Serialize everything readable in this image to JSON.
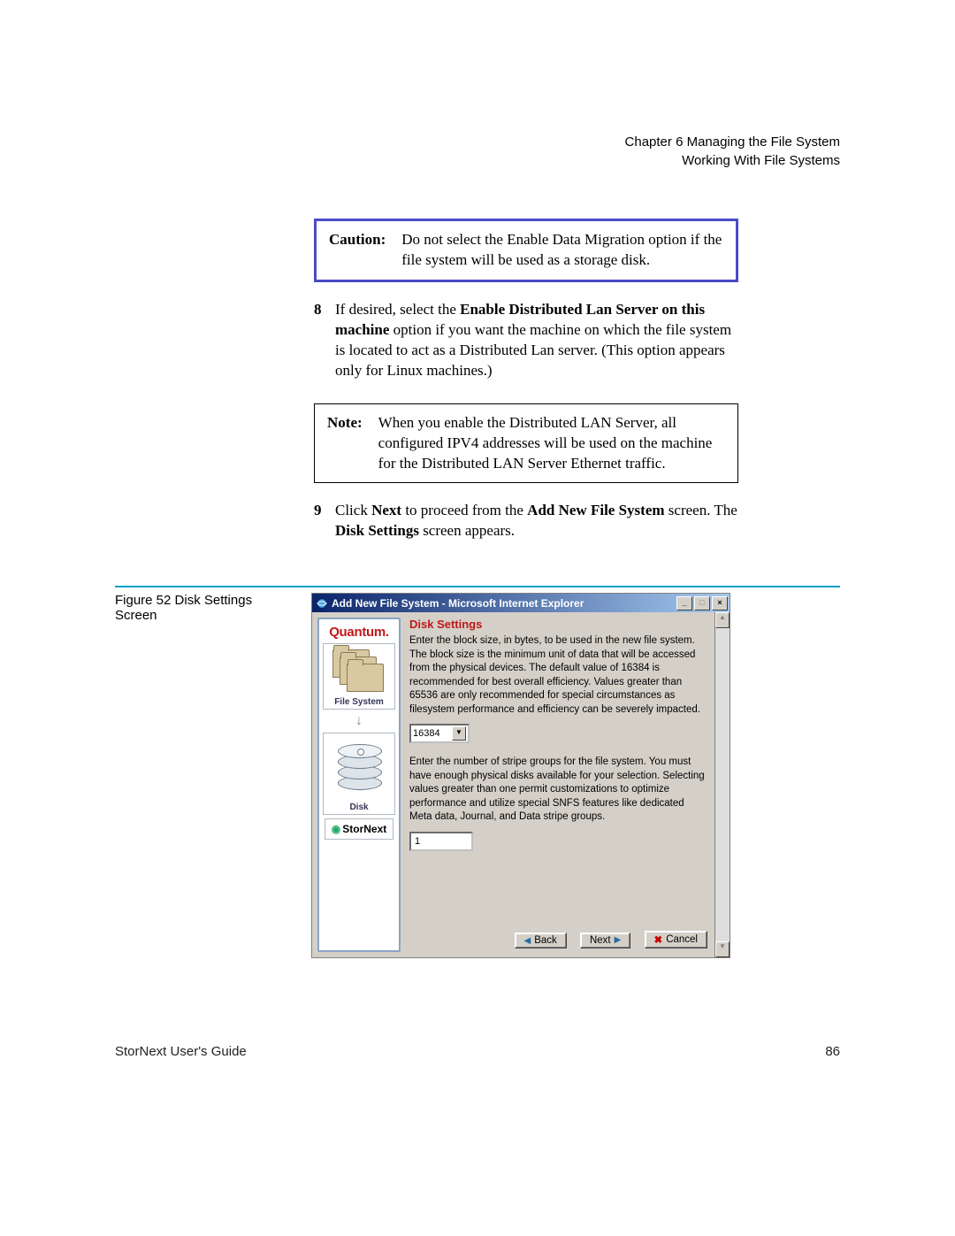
{
  "header": {
    "chapter_line": "Chapter 6  Managing the File System",
    "section_line": "Working With File Systems"
  },
  "caution": {
    "label": "Caution:",
    "text": "Do not select the Enable Data Migration option if the file system will be used as a storage disk."
  },
  "step8": {
    "num": "8",
    "prefix": "If desired, select the ",
    "bold1": "Enable Distributed Lan Server on this machine",
    "suffix": " option if you want the machine on which the file system is located to act as a Distributed Lan server. (This option appears only for Linux machines.)"
  },
  "note": {
    "label": "Note:",
    "text": "When you enable the Distributed LAN Server, all configured IPV4 addresses will be used on the machine for the Distributed LAN Server Ethernet traffic."
  },
  "step9": {
    "num": "9",
    "t1": "Click ",
    "b1": "Next",
    "t2": " to proceed from the ",
    "b2": "Add New File System",
    "t3": " screen. The ",
    "b3": "Disk Settings",
    "t4": " screen appears."
  },
  "figure": {
    "caption": "Figure 52  Disk Settings Screen"
  },
  "screenshot": {
    "title": "Add New File System - Microsoft Internet Explorer",
    "sidebar": {
      "brand": "Quantum.",
      "fs_label": "File System",
      "disk_label": "Disk",
      "stornext": "StorNext"
    },
    "panel_title": "Disk Settings",
    "para1": "Enter the block size, in bytes, to be used in the new file system. The block size is the minimum unit of data that will be accessed from the physical devices. The default value of 16384 is recommended for best overall efficiency. Values greater than 65536 are only recommended for special circumstances as filesystem performance and efficiency can be severely impacted.",
    "block_size_value": "16384",
    "para2": "Enter the number of stripe groups for the file system. You must have enough physical disks available for your selection. Selecting values greater than one permit customizations to optimize performance and utilize special SNFS features like dedicated Meta data, Journal, and Data stripe groups.",
    "stripe_groups_value": "1",
    "buttons": {
      "back": "Back",
      "next": "Next",
      "cancel": "Cancel"
    }
  },
  "footer": {
    "left": "StorNext User's Guide",
    "page": "86"
  }
}
